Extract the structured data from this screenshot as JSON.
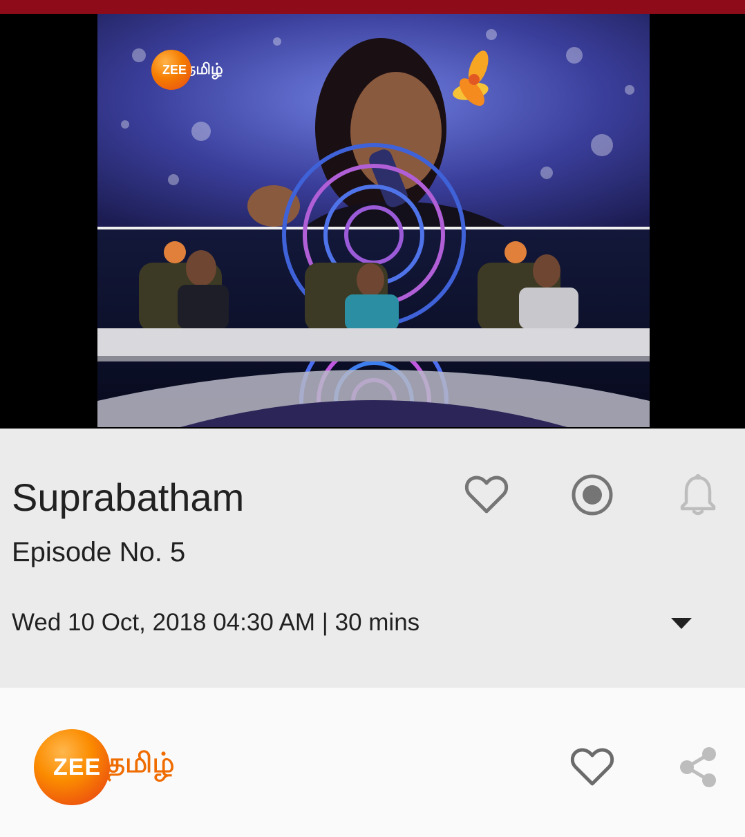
{
  "video": {
    "watermark_zee": "ZEE",
    "watermark_tamil": "தமிழ்"
  },
  "program": {
    "title": "Suprabatham",
    "episode": "Episode No. 5",
    "schedule": "Wed 10 Oct, 2018 04:30 AM | 30 mins"
  },
  "actions": {
    "favorite_icon": "heart-outline-icon",
    "record_icon": "record-icon",
    "reminder_icon": "bell-icon",
    "expand_icon": "caret-down-icon",
    "share_icon": "share-icon"
  },
  "channel": {
    "logo_zee": "ZEE",
    "logo_tamil": "தமிழ்"
  },
  "colors": {
    "status_bar": "#8e0b1a",
    "panel_bg": "#ebebeb",
    "bottom_bg": "#fafafa",
    "brand_orange": "#ef6c00",
    "icon_gray": "#757575"
  }
}
